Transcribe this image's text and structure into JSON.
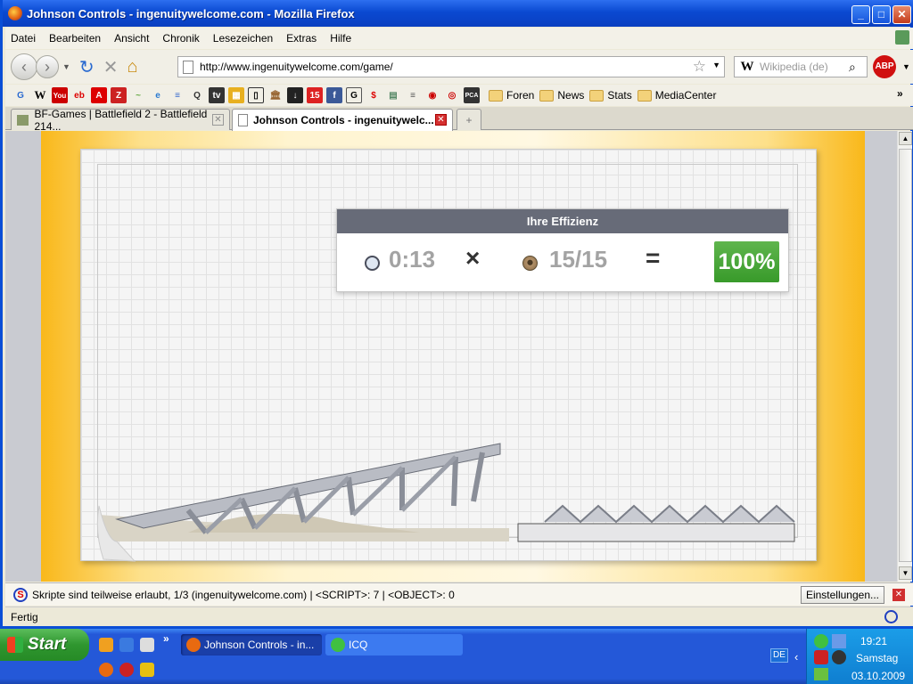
{
  "window": {
    "title": "Johnson Controls - ingenuitywelcome.com - Mozilla Firefox",
    "minimize_label": "_",
    "maximize_label": "□",
    "close_label": "✕"
  },
  "menu": [
    "Datei",
    "Bearbeiten",
    "Ansicht",
    "Chronik",
    "Lesezeichen",
    "Extras",
    "Hilfe"
  ],
  "nav": {
    "back_label": "‹",
    "forward_label": "›",
    "reload_label": "↻",
    "stop_label": "✕",
    "home_label": "⌂",
    "url": "http://www.ingenuitywelcome.com/game/",
    "star_label": "☆",
    "dropdown_label": "▼",
    "search_engine": "W",
    "search_placeholder": "Wikipedia (de)",
    "search_button": "⌕",
    "adblock_label": "ABP"
  },
  "bookmarks": {
    "icons": [
      "G",
      "W",
      "You",
      "eb",
      "A",
      "Z",
      "~",
      "e",
      "≡",
      "Q",
      "tv",
      "▦",
      "▯",
      "🏛",
      "↓",
      "15",
      "f",
      "G",
      "$",
      "▤",
      "≡",
      "◉",
      "◎",
      "PCA"
    ],
    "folders": [
      "Foren",
      "News",
      "Stats",
      "MediaCenter"
    ],
    "more_label": "»"
  },
  "tabs": [
    {
      "label": "BF-Games | Battlefield 2 - Battlefield 214...",
      "close": "✕"
    },
    {
      "label": "Johnson Controls - ingenuitywelc...",
      "close": "✕"
    }
  ],
  "newtab_label": "+",
  "game": {
    "panel_title": "Ihre Effizienz",
    "time": "0:13",
    "times_sign": "×",
    "nuts": "15/15",
    "equals_sign": "=",
    "efficiency": "100%"
  },
  "scroll": {
    "up": "▲",
    "down": "▼"
  },
  "noscript": {
    "icon": "S",
    "message": "Skripte sind teilweise erlaubt, 1/3 (ingenuitywelcome.com) | <SCRIPT>: 7 | <OBJECT>: 0",
    "settings_button": "Einstellungen...",
    "close": "✕"
  },
  "status": "Fertig",
  "taskbar": {
    "start": "Start",
    "quick_more": "»",
    "tasks": [
      "Johnson Controls - in...",
      "ICQ"
    ],
    "lang": "DE",
    "tray_arrow": "‹",
    "time": "19:21",
    "day": "Samstag",
    "date": "03.10.2009"
  },
  "colors": {
    "accent_green": "#389a2a",
    "panel_header": "#676b78",
    "xp_blue": "#2458d8"
  }
}
